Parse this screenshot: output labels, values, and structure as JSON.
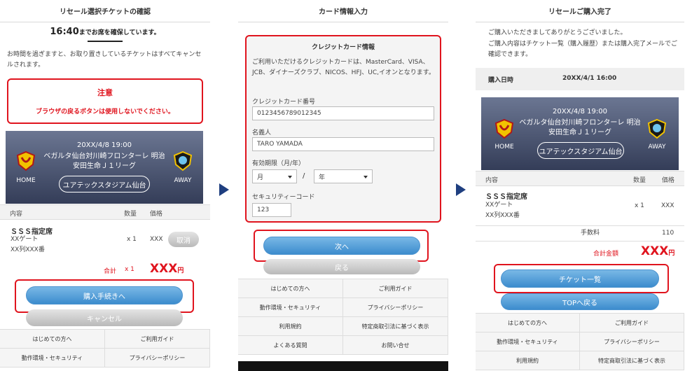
{
  "screen1": {
    "title": "リセール選択チケットの確認",
    "hold_time": "16:40",
    "hold_suffix": "までお席を確保しています。",
    "cancel_notice": "お時間を過ぎますと、お取り置きしているチケットはすべてキャンセルされます。",
    "warning_title": "注意",
    "warning_text": "ブラウザの戻るボタンは使用しないでください。",
    "match": {
      "datetime": "20XX/4/8 19:00",
      "teams": "ベガルタ仙台対川崎フロンターレ 明治安田生命Ｊ１リーグ",
      "venue": "ユアテックスタジアム仙台",
      "home": "HOME",
      "away": "AWAY"
    },
    "table_head": {
      "content": "内容",
      "qty": "数量",
      "price": "価格"
    },
    "seat": {
      "name": "ＳＳＳ指定席",
      "gate": "XXゲート",
      "row": "XX列XXX番",
      "qty": "x 1",
      "price": "XXX",
      "cancel_btn": "取消"
    },
    "total": {
      "label": "合計",
      "qty": "x 1",
      "amount": "XXX",
      "unit": "円"
    },
    "proceed_btn": "購入手続きへ",
    "cancel_btn": "キャンセル",
    "footer": [
      "はじめての方へ",
      "ご利用ガイド",
      "動作環境・セキュリティ",
      "プライバシーポリシー"
    ]
  },
  "screen2": {
    "title": "カード情報入力",
    "section_title": "クレジットカード情報",
    "intro": "ご利用いただけるクレジットカードは、MasterCard、VISA、JCB、ダイナーズクラブ、NICOS、HFJ、UC,イオンとなります。",
    "card_label": "クレジットカード番号",
    "card_value": "0123456789012345",
    "name_label": "名義人",
    "name_value": "TARO YAMADA",
    "expiry_label": "有効期限（月/年）",
    "month": "月",
    "slash": "/",
    "year": "年",
    "cvc_label": "セキュリティーコード",
    "cvc_value": "123",
    "next_btn": "次へ",
    "back_btn": "戻る",
    "footer": [
      "はじめての方へ",
      "ご利用ガイド",
      "動作環境・セキュリティ",
      "プライバシーポリシー",
      "利用規約",
      "特定商取引法に基づく表示",
      "よくある質問",
      "お問い合せ"
    ]
  },
  "screen3": {
    "title": "リセールご購入完了",
    "thanks": "ご購入いただきましてありがとうございました。",
    "info": "ご購入内容はチケット一覧（購入履歴）または購入完了メールでご確認できます。",
    "purchase_label": "購入日時",
    "purchase_value": "20XX/4/1 16:00",
    "match": {
      "datetime": "20XX/4/8 19:00",
      "teams": "ベガルタ仙台対川崎フロンターレ 明治安田生命Ｊ１リーグ",
      "venue": "ユアテックスタジアム仙台",
      "home": "HOME",
      "away": "AWAY"
    },
    "table_head": {
      "content": "内容",
      "qty": "数量",
      "price": "価格"
    },
    "seat": {
      "name": "ＳＳＳ指定席",
      "gate": "XXゲート",
      "row": "XX列XXX番",
      "qty": "x 1",
      "price": "XXX"
    },
    "fee": {
      "label": "手数料",
      "value": "110"
    },
    "total": {
      "label": "合計金額",
      "amount": "XXX",
      "unit": "円"
    },
    "ticket_list_btn": "チケット一覧",
    "top_btn": "TOPへ戻る",
    "footer": [
      "はじめての方へ",
      "ご利用ガイド",
      "動作環境・セキュリティ",
      "プライバシーポリシー",
      "利用規約",
      "特定商取引法に基づく表示"
    ]
  },
  "colors": {
    "accent_red": "#e0141e",
    "button_blue": "#3c8ccd",
    "arrow_navy": "#1f3f80"
  }
}
